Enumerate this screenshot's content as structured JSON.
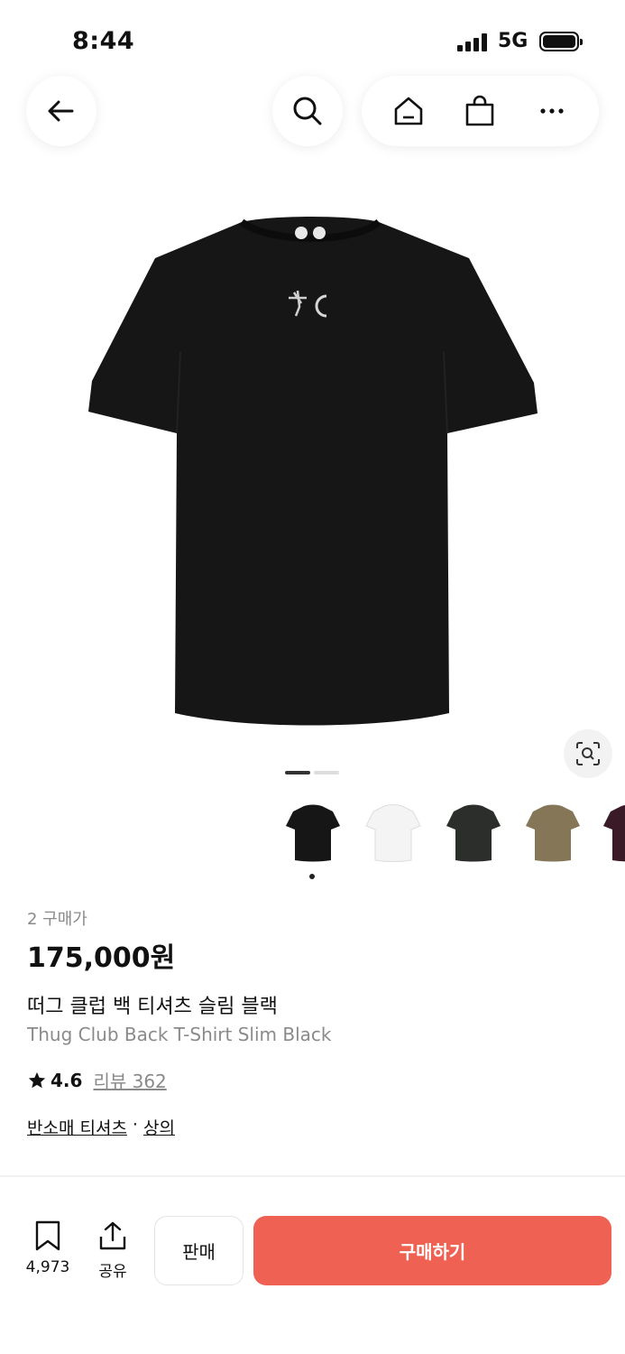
{
  "status_bar": {
    "time": "8:44",
    "network": "5G"
  },
  "nav": {
    "back_icon": "arrow-left-icon",
    "search_icon": "search-icon",
    "home_icon": "home-icon",
    "cart_icon": "shopping-bag-icon",
    "more_icon": "more-horizontal-icon"
  },
  "product": {
    "image_pages": {
      "current": 1,
      "total": 2
    },
    "color_options": [
      "black",
      "white",
      "charcoal",
      "olive-brown",
      "burgundy"
    ],
    "selected_color_index": 0,
    "buyers": "2 구매가",
    "price": "175,000원",
    "name_ko": "떠그 클럽 백 티셔츠 슬림 블랙",
    "name_en": "Thug Club Back T-Shirt Slim Black",
    "rating": "4.6",
    "reviews": "리뷰 362",
    "category_primary": "반소매 티셔츠",
    "category_separator": "·",
    "category_secondary": "상의"
  },
  "bottom_bar": {
    "bookmark_count": "4,973",
    "share_label": "공유",
    "sell_label": "판매",
    "buy_label": "구매하기"
  },
  "colors": {
    "accent": "#ef6253",
    "shirt_black": "#1a1a1a"
  }
}
